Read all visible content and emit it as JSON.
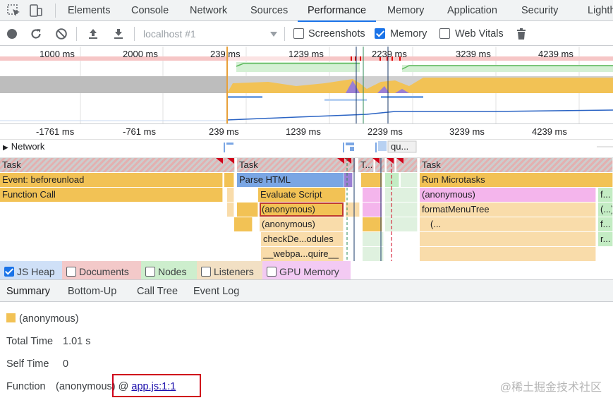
{
  "devtools": {
    "tabs": [
      "Elements",
      "Console",
      "Network",
      "Sources",
      "Performance",
      "Memory",
      "Application",
      "Security",
      "Lighthouse"
    ],
    "active_tab": "Performance"
  },
  "toolbar": {
    "profile_select": "localhost #1",
    "screenshots_label": "Screenshots",
    "screenshots_checked": false,
    "memory_label": "Memory",
    "memory_checked": true,
    "web_vitals_label": "Web Vitals",
    "web_vitals_checked": false
  },
  "overview": {
    "ticks": [
      "1000 ms",
      "2000 ms",
      "239 ms",
      "1239 ms",
      "2239 ms",
      "3239 ms",
      "4239 ms"
    ]
  },
  "ruler": {
    "ticks": [
      "-1761 ms",
      "-761 ms",
      "239 ms",
      "1239 ms",
      "2239 ms",
      "3239 ms",
      "4239 ms"
    ]
  },
  "network": {
    "label": "Network",
    "short_label": "qu..."
  },
  "flame": {
    "task": "Task",
    "task_short": "T...",
    "event_beforeunload": "Event: beforeunload",
    "function_call": "Function Call",
    "parse_html": "Parse HTML",
    "evaluate_script": "Evaluate Script",
    "anonymous": "(anonymous)",
    "check_modules": "checkDe...odules",
    "webpack_require": "__webpa...quire__",
    "run_microtasks": "Run Microtasks",
    "format_menu_tree": "formatMenuTree",
    "ellipsis_paren": "(...",
    "f_dots": "f...",
    "anon_dots": "(...)",
    "r_dots": "r..."
  },
  "counters": [
    {
      "label": "JS Heap",
      "checked": true,
      "color": "#2b64c4"
    },
    {
      "label": "Documents",
      "checked": false,
      "color": "#e06666"
    },
    {
      "label": "Nodes",
      "checked": false,
      "color": "#7bd37b"
    },
    {
      "label": "Listeners",
      "checked": false,
      "color": "#e4c08a"
    },
    {
      "label": "GPU Memory",
      "checked": false,
      "color": "#e07be0"
    }
  ],
  "bottom_tabs": [
    "Summary",
    "Bottom-Up",
    "Call Tree",
    "Event Log"
  ],
  "bottom_active": "Summary",
  "summary": {
    "title": "(anonymous)",
    "swatch_color": "#f2c255",
    "total_time_label": "Total Time",
    "total_time_value": "1.01 s",
    "self_time_label": "Self Time",
    "self_time_value": "0",
    "function_label": "Function",
    "function_value": "(anonymous) @",
    "function_link": "app.js:1:1"
  },
  "watermark": "@稀土掘金技术社区",
  "colors": {
    "accent": "#1a73e8",
    "scripting": "#f2c255",
    "rendering_purple": "#9b7fd4",
    "loading_blue": "#7aa6e4",
    "highlight_red": "#d0021b"
  }
}
